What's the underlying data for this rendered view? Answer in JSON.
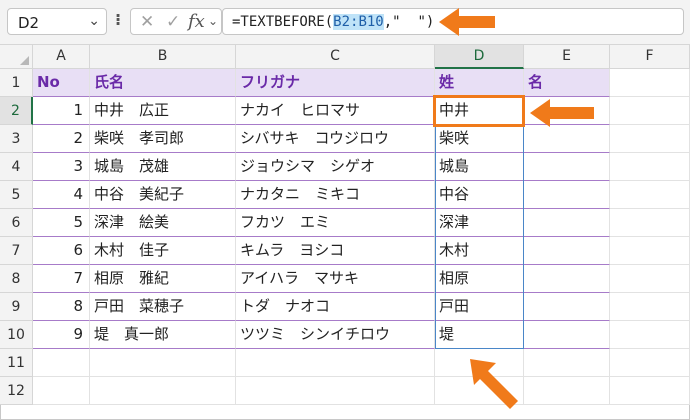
{
  "namebox": {
    "value": "D2"
  },
  "formula_bar": {
    "prefix": "=TEXTBEFORE(",
    "range_ref": "B2:B10",
    "suffix": ",\"  \")"
  },
  "columns": [
    "A",
    "B",
    "C",
    "D",
    "E",
    "F"
  ],
  "rows": [
    "1",
    "2",
    "3",
    "4",
    "5",
    "6",
    "7",
    "8",
    "9",
    "10",
    "11",
    "12"
  ],
  "header": {
    "no": "No",
    "name": "氏名",
    "furigana": "フリガナ",
    "sei": "姓",
    "mei": "名"
  },
  "records": [
    {
      "no": "1",
      "name": "中井　広正",
      "furigana": "ナカイ　ヒロマサ",
      "sei": "中井"
    },
    {
      "no": "2",
      "name": "柴咲　孝司郎",
      "furigana": "シバサキ　コウジロウ",
      "sei": "柴咲"
    },
    {
      "no": "3",
      "name": "城島　茂雄",
      "furigana": "ジョウシマ　シゲオ",
      "sei": "城島"
    },
    {
      "no": "4",
      "name": "中谷　美紀子",
      "furigana": "ナカタニ　ミキコ",
      "sei": "中谷"
    },
    {
      "no": "5",
      "name": "深津　絵美",
      "furigana": "フカツ　エミ",
      "sei": "深津"
    },
    {
      "no": "6",
      "name": "木村　佳子",
      "furigana": "キムラ　ヨシコ",
      "sei": "木村"
    },
    {
      "no": "7",
      "name": "相原　雅紀",
      "furigana": "アイハラ　マサキ",
      "sei": "相原"
    },
    {
      "no": "8",
      "name": "戸田　菜穂子",
      "furigana": "トダ　ナオコ",
      "sei": "戸田"
    },
    {
      "no": "9",
      "name": "堤　真一郎",
      "furigana": "ツツミ　シンイチロウ",
      "sei": "堤"
    }
  ],
  "colors": {
    "accent": "#f07a1a",
    "header_bg": "#e8dff5",
    "header_text": "#6a2aa8",
    "spill_border": "#4a86c8"
  }
}
